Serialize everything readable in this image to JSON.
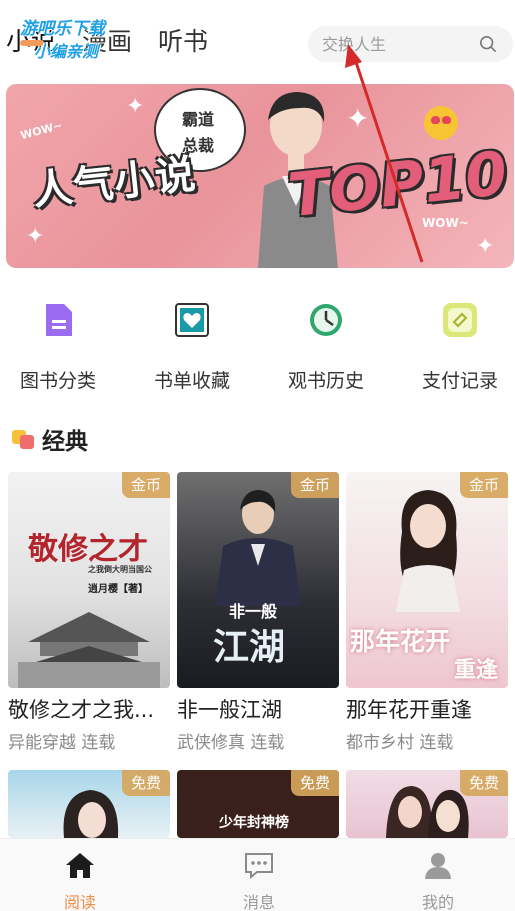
{
  "header": {
    "tabs": [
      {
        "label": "小说",
        "active": true
      },
      {
        "label": "漫画",
        "active": false
      },
      {
        "label": "听书",
        "active": false
      }
    ],
    "watermark": [
      "游吧乐下载",
      "小编亲测"
    ],
    "search": {
      "placeholder": "交换人生",
      "icon": "search-icon"
    }
  },
  "banner": {
    "title": "人气小说",
    "highlight": "TOP10",
    "bubble": [
      "霸道",
      "总裁"
    ],
    "wow_left": "WOW~",
    "wow_right": "WOW~"
  },
  "quick_actions": [
    {
      "label": "图书分类",
      "icon": "document-icon",
      "color": "#9b6cf0"
    },
    {
      "label": "书单收藏",
      "icon": "heart-frame-icon",
      "color": "#1a9aa6"
    },
    {
      "label": "观书历史",
      "icon": "clock-icon",
      "color": "#2fa66b"
    },
    {
      "label": "支付记录",
      "icon": "ticket-icon",
      "color": "#c8d84a"
    }
  ],
  "section": {
    "title": "经典",
    "books": [
      {
        "title": "敬修之才之我...",
        "genre": "异能穿越",
        "status": "连载",
        "badge": "金币",
        "cover_text": "敬修之才",
        "cover_sub": "之我倒大明当国公",
        "author": "逍月樱【著】"
      },
      {
        "title": "非一般江湖",
        "genre": "武侠修真",
        "status": "连载",
        "badge": "金币",
        "cover_text": "江湖",
        "cover_sub": "非一般"
      },
      {
        "title": "那年花开重逢",
        "genre": "都市乡村",
        "status": "连载",
        "badge": "金币",
        "cover_text": "那年花开",
        "cover_sub": "重逢"
      }
    ],
    "more_books": [
      {
        "badge": "免费"
      },
      {
        "badge": "免费",
        "cover_text": "少年封神榜"
      },
      {
        "badge": "免费"
      }
    ]
  },
  "tabbar": [
    {
      "label": "阅读",
      "icon": "home-icon",
      "active": true
    },
    {
      "label": "消息",
      "icon": "message-icon",
      "active": false
    },
    {
      "label": "我的",
      "icon": "user-icon",
      "active": false
    }
  ],
  "colors": {
    "accent": "#f08c4c",
    "badge": "#d6a65c",
    "annotation_arrow": "#d42a2a"
  }
}
